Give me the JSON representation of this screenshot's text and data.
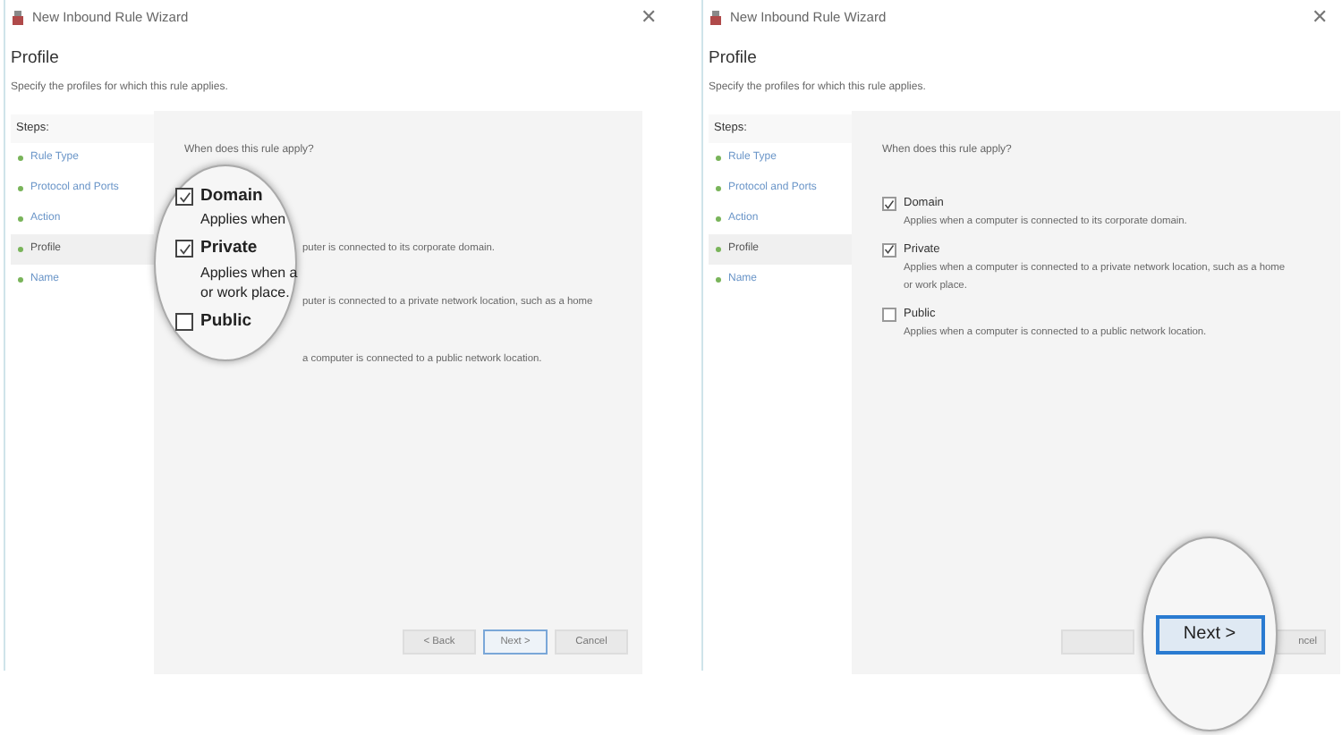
{
  "panels": [
    {
      "window_title": "New Inbound Rule Wizard",
      "close": "✕",
      "heading": "Profile",
      "subheading": "Specify the profiles for which this rule applies.",
      "steps_label": "Steps:",
      "steps": [
        {
          "label": "Rule Type",
          "selected": false
        },
        {
          "label": "Protocol and Ports",
          "selected": false
        },
        {
          "label": "Action",
          "selected": false
        },
        {
          "label": "Profile",
          "selected": true
        },
        {
          "label": "Name",
          "selected": false
        }
      ],
      "question": "When does this rule apply?",
      "options": [
        {
          "kind": "tail",
          "description": [
            "puter is connected to its corporate domain."
          ]
        },
        {
          "kind": "tail",
          "description": [
            "puter is connected to a private network location, such as a home"
          ]
        },
        {
          "kind": "tail",
          "description": [
            "a computer is connected to a public network location."
          ]
        }
      ],
      "magnifier": {
        "kind": "options",
        "options": [
          {
            "label": "Domain",
            "checked": true,
            "description": [
              "Applies when"
            ]
          },
          {
            "label": "Private",
            "checked": true,
            "description": [
              "Applies when a",
              "or work place."
            ]
          },
          {
            "label": "Public",
            "checked": false
          }
        ]
      },
      "buttons": [
        {
          "kind": "normal",
          "label": "< Back",
          "default": false
        },
        {
          "kind": "normal",
          "label": "Next >",
          "default": true
        },
        {
          "kind": "normal",
          "label": "Cancel",
          "default": false
        }
      ]
    },
    {
      "window_title": "New Inbound Rule Wizard",
      "close": "✕",
      "heading": "Profile",
      "subheading": "Specify the profiles for which this rule applies.",
      "steps_label": "Steps:",
      "steps": [
        {
          "label": "Rule Type",
          "selected": false
        },
        {
          "label": "Protocol and Ports",
          "selected": false
        },
        {
          "label": "Action",
          "selected": false
        },
        {
          "label": "Profile",
          "selected": true
        },
        {
          "label": "Name",
          "selected": false
        }
      ],
      "question": "When does this rule apply?",
      "options": [
        {
          "kind": "full",
          "label": "Domain",
          "checked": true,
          "description": [
            "Applies when a computer is connected to its corporate domain."
          ]
        },
        {
          "kind": "full",
          "label": "Private",
          "checked": true,
          "description": [
            "Applies when a computer is connected to a private network location, such as a home",
            "or work place."
          ]
        },
        {
          "kind": "full",
          "label": "Public",
          "checked": false,
          "description": [
            "Applies when a computer is connected to a public network location."
          ]
        }
      ],
      "magnifier": {
        "kind": "button"
      },
      "buttons": [
        {
          "kind": "covered",
          "default": false
        },
        {
          "kind": "magnified",
          "label": "Next >",
          "default": true
        },
        {
          "kind": "cut",
          "label": "ncel",
          "default": false
        }
      ]
    }
  ]
}
